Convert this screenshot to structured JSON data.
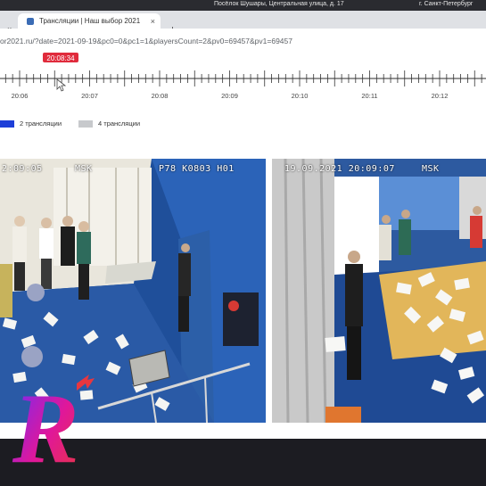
{
  "header": {
    "address_left": "Посёлок Шушары, Центральная улица, д. 17",
    "address_right": "г. Санкт-Петербург"
  },
  "browser": {
    "tab_title": "Трансляции | Наш выбор 2021",
    "close_glyph": "×",
    "new_tab_glyph": "+",
    "url": "or2021.ru/?date=2021-09-19&pc0=0&pc1=1&playersCount=2&pv0=69457&pv1=69457"
  },
  "timeline": {
    "current_time": "20:08:34",
    "current_time_progress": 0.19,
    "labels": [
      "20:06",
      "20:07",
      "20:08",
      "20:09",
      "20:10",
      "20:11",
      "20:12"
    ],
    "marker_position_minutes": 20.09,
    "marker_color": "#d42a3c",
    "bubble_color": "#e02b3c"
  },
  "legend": {
    "items": [
      {
        "label": "2 трансляции",
        "color": "#1e3fd8"
      },
      {
        "label": "4 трансляции",
        "color": "#c7c9cc"
      }
    ]
  },
  "feeds": [
    {
      "timestamp": "2:09:05",
      "zone": "MSK",
      "station": "P78 K0803 H01"
    },
    {
      "timestamp": "19.09.2021 20:09:07",
      "zone": "MSK",
      "station": ""
    }
  ],
  "watermark": {
    "letter": "R",
    "colors": [
      "#6a2cff",
      "#e0179a",
      "#e8363f"
    ]
  }
}
